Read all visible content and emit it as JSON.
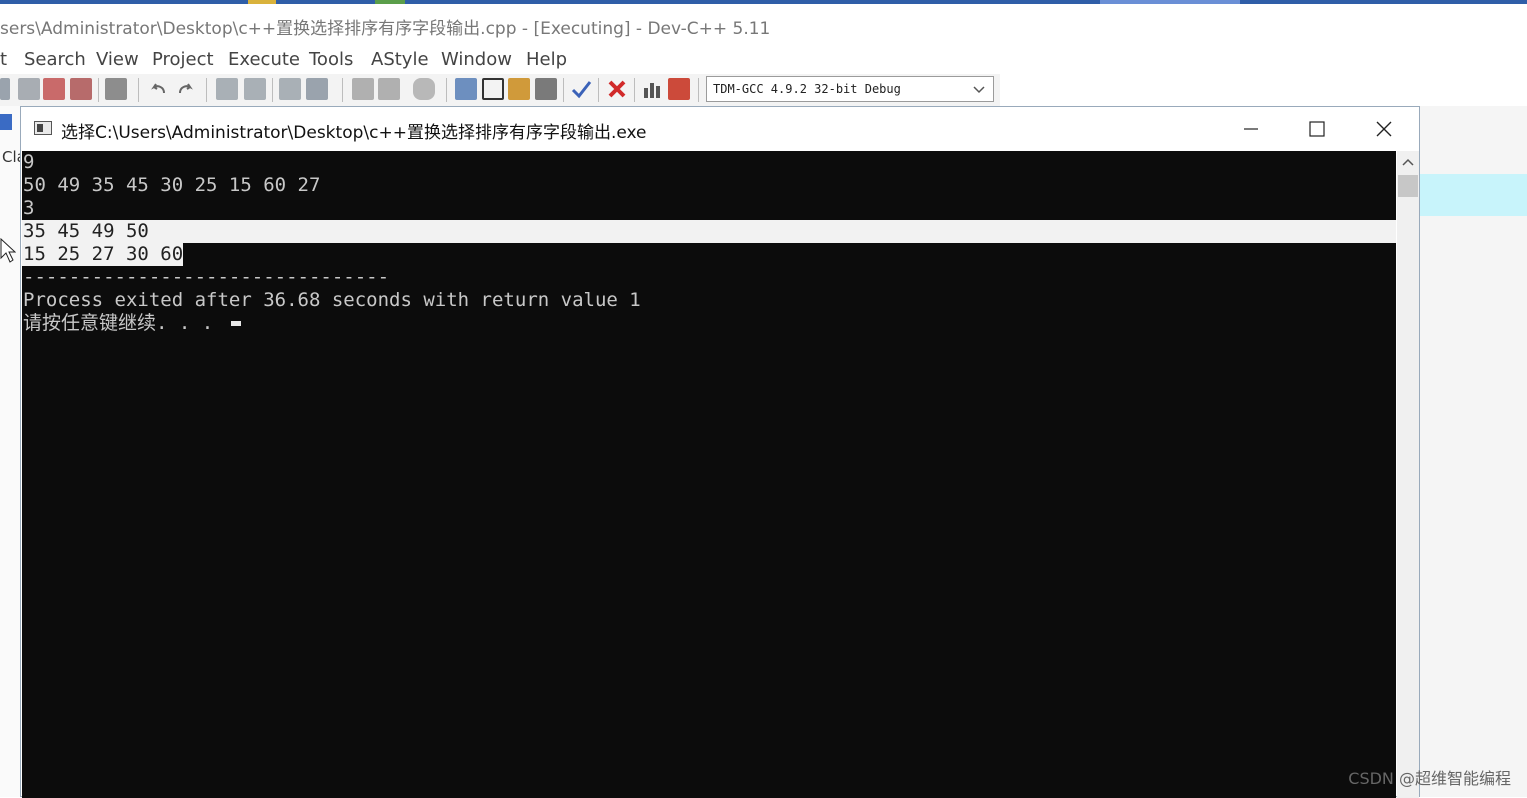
{
  "ide": {
    "title": "sers\\Administrator\\Desktop\\c++置换选择排序有序字段输出.cpp - [Executing] - Dev-C++ 5.11",
    "menu": [
      "t",
      "Search",
      "View",
      "Project",
      "Execute",
      "Tools",
      "AStyle",
      "Window",
      "Help"
    ],
    "compiler_select": "TDM-GCC 4.9.2 32-bit Debug",
    "left_tab_label": "Cla"
  },
  "console_window": {
    "title": "选择C:\\Users\\Administrator\\Desktop\\c++置换选择排序有序字段输出.exe",
    "lines": [
      "9",
      "50 49 35 45 30 25 15 60 27",
      "3",
      "35 45 49 50",
      "15 25 27 30 60",
      "--------------------------------",
      "Process exited after 36.68 seconds with return value 1",
      "请按任意键继续. . . "
    ]
  },
  "watermark": "CSDN @超维智能编程",
  "colors": {
    "console_bg": "#0c0c0c",
    "console_text": "#c8c8c8",
    "selection": "#f2f2f2",
    "accent_cyan": "#c8f4fb"
  }
}
